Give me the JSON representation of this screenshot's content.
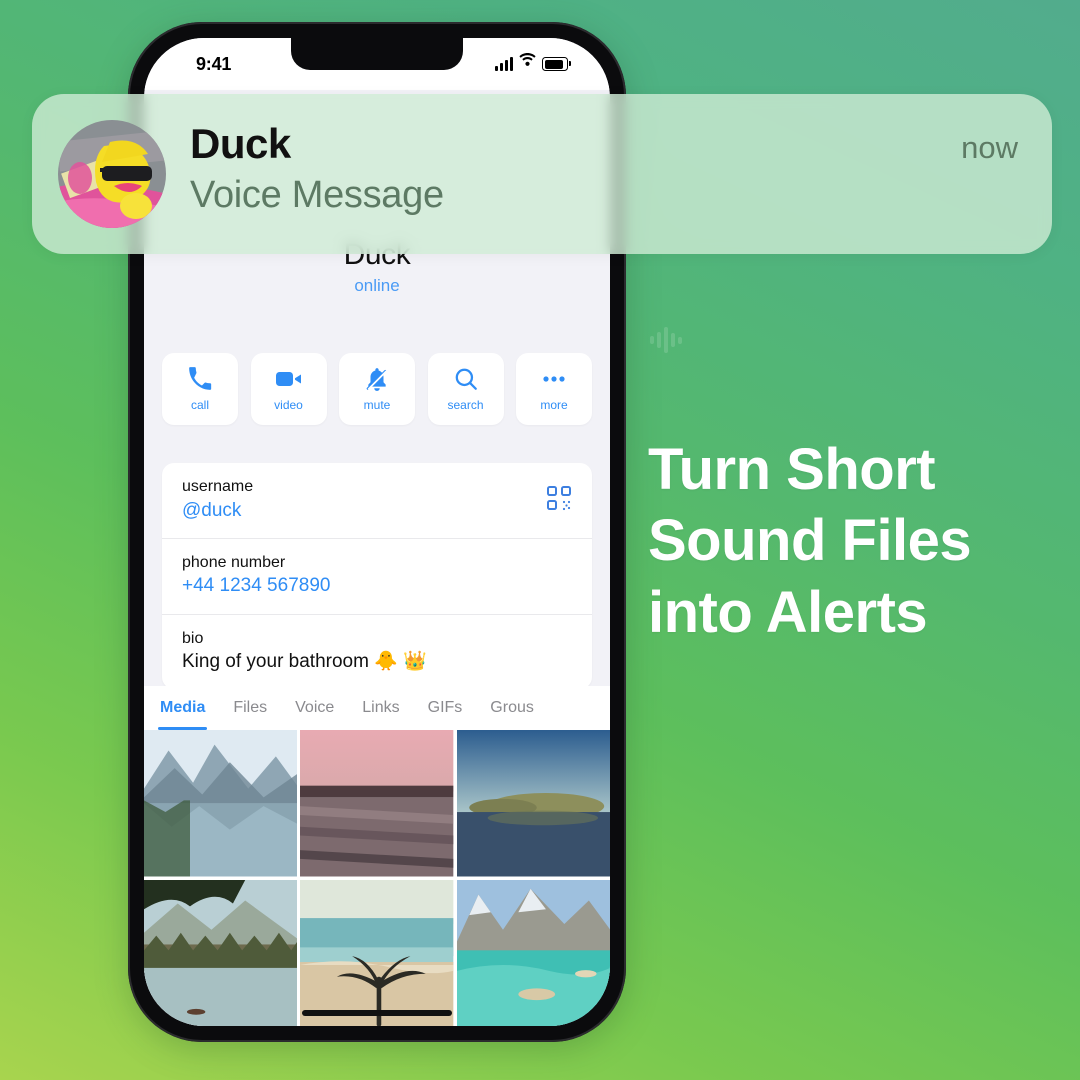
{
  "promo": {
    "headline_lines": [
      "Turn Short",
      "Sound Files",
      "into Alerts"
    ],
    "accent_color": "#ffffff",
    "background_from": "#52ac8d",
    "background_to": "#a8d44e"
  },
  "decor": {
    "waveform_icon": "audio-waveform-icon"
  },
  "phone": {
    "status_bar": {
      "time": "9:41",
      "signal_icon": "cellular-signal-icon",
      "wifi_icon": "wifi-icon",
      "battery_icon": "battery-full-icon"
    },
    "profile": {
      "name": "Duck",
      "status": "online",
      "status_color": "#4a9bf5"
    },
    "actions": [
      {
        "label": "call",
        "icon": "phone-icon"
      },
      {
        "label": "video",
        "icon": "video-camera-icon"
      },
      {
        "label": "mute",
        "icon": "bell-slash-icon"
      },
      {
        "label": "search",
        "icon": "magnifier-icon"
      },
      {
        "label": "more",
        "icon": "ellipsis-icon"
      }
    ],
    "info_rows": [
      {
        "key": "username",
        "value": "@duck",
        "value_style": "link",
        "trailing_icon": "qr-code-icon"
      },
      {
        "key": "phone number",
        "value": "+44 1234 567890",
        "value_style": "link"
      },
      {
        "key": "bio",
        "value": "King of your bathroom 🐥 👑",
        "value_style": "plain"
      }
    ],
    "tabs": [
      {
        "label": "Media",
        "active": true
      },
      {
        "label": "Files",
        "active": false
      },
      {
        "label": "Voice",
        "active": false
      },
      {
        "label": "Links",
        "active": false
      },
      {
        "label": "GIFs",
        "active": false
      },
      {
        "label": "Grous",
        "active": false
      }
    ],
    "media_grid": [
      {
        "alt": "mountain lake reflection"
      },
      {
        "alt": "pink sunset over lake"
      },
      {
        "alt": "golden hour lake island"
      },
      {
        "alt": "forest lake with trees"
      },
      {
        "alt": "beach with palm shadow"
      },
      {
        "alt": "turquoise alpine lake with boat"
      }
    ],
    "home_indicator": "home-indicator"
  },
  "notification": {
    "avatar_alt": "rubber duck with sunglasses",
    "title": "Duck",
    "subtitle": "Voice Message",
    "time": "now",
    "tint": "#ceebd5"
  }
}
